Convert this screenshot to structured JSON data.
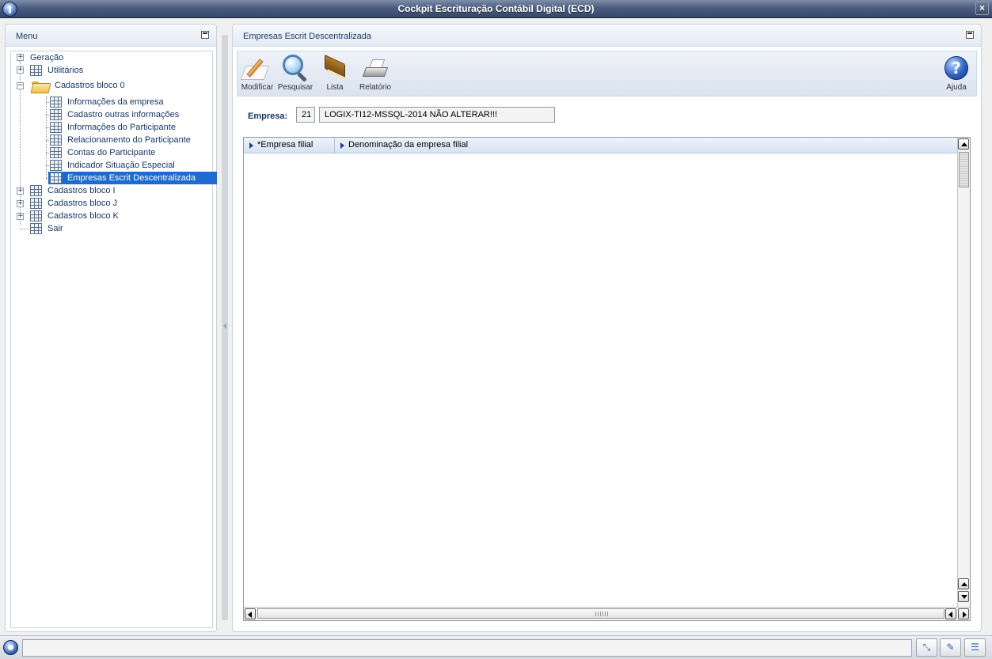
{
  "window": {
    "title": "Cockpit Escrituração Contábil Digital (ECD)",
    "close_label": "×"
  },
  "menu_panel": {
    "title": "Menu",
    "items": [
      {
        "label": "Geração"
      },
      {
        "label": "Utilitários"
      },
      {
        "label": "Cadastros bloco 0"
      },
      {
        "label": "Informações da empresa"
      },
      {
        "label": "Cadastro outras informações"
      },
      {
        "label": "Informações do Participante"
      },
      {
        "label": "Relacionamento do Participante"
      },
      {
        "label": "Contas do Participante"
      },
      {
        "label": "Indicador Situação Especial"
      },
      {
        "label": "Empresas Escrit Descentralizada"
      },
      {
        "label": "Cadastros bloco I"
      },
      {
        "label": "Cadastros bloco J"
      },
      {
        "label": "Cadastros bloco K"
      },
      {
        "label": "Sair"
      }
    ]
  },
  "main_panel": {
    "title": "Empresas Escrit Descentralizada",
    "toolbar": {
      "modify_label": "Modificar",
      "search_label": "Pesquisar",
      "list_label": "Lista",
      "report_label": "Relatório",
      "help_label": "Ajuda"
    },
    "empresa": {
      "label": "Empresa:",
      "code": "21",
      "name": "LOGIX-TI12-MSSQL-2014 NÃO ALTERAR!!!"
    },
    "grid": {
      "columns": [
        "*Empresa filial",
        "Denominação da empresa filial"
      ],
      "rows": []
    }
  },
  "icons": {
    "modify": "edit-pencil-icon",
    "search": "magnifier-icon",
    "list": "book-icon",
    "report": "printer-icon",
    "help": "question-mark-icon"
  },
  "colors": {
    "selection": "#1c6bd0",
    "title_bar": "#4b5d80"
  }
}
